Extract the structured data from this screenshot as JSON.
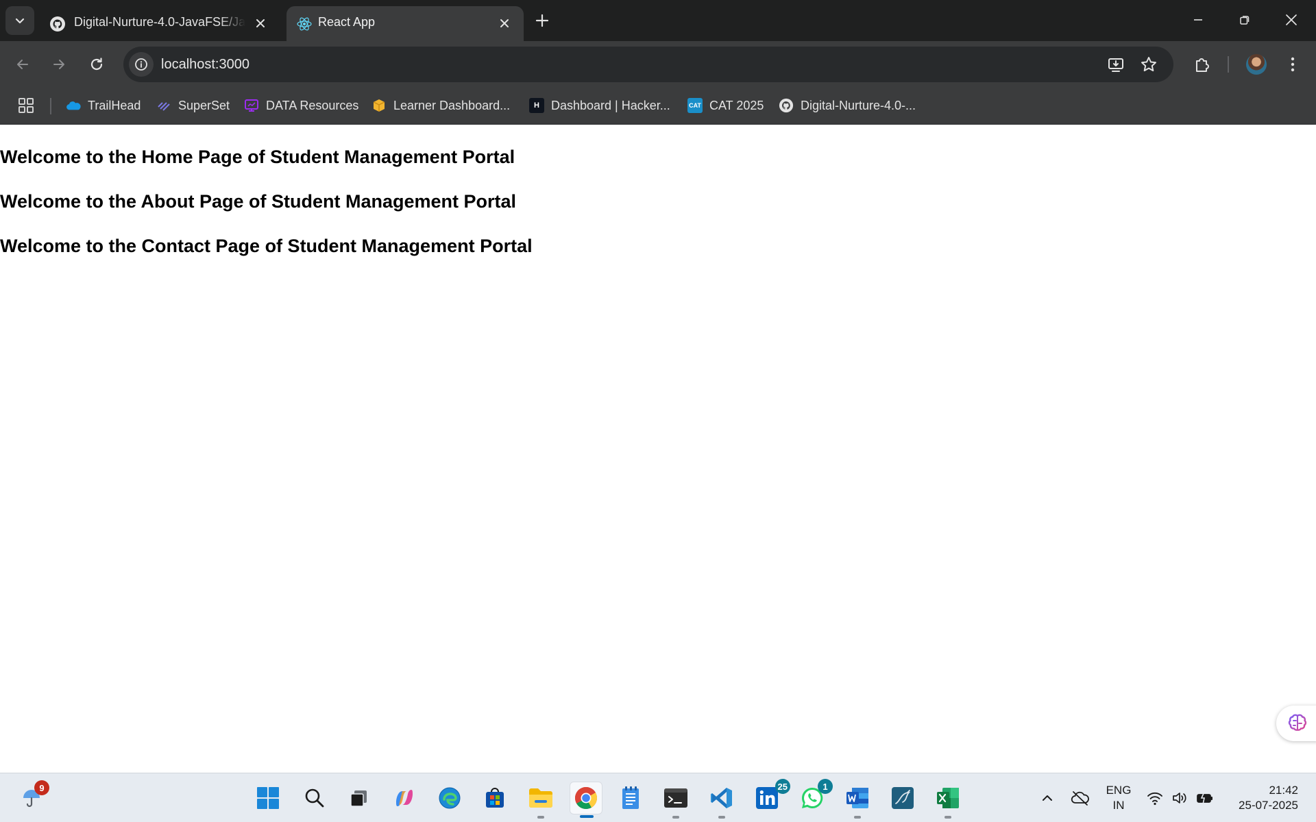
{
  "browser": {
    "tabs": [
      {
        "title": "Digital-Nurture-4.0-JavaFSE/Java",
        "active": false,
        "icon": "github-icon"
      },
      {
        "title": "React App",
        "active": true,
        "icon": "react-icon"
      }
    ],
    "url": "localhost:3000",
    "bookmarks": [
      {
        "label": "TrailHead",
        "icon": "salesforce-cloud-icon"
      },
      {
        "label": "SuperSet",
        "icon": "superset-icon"
      },
      {
        "label": "DATA Resources",
        "icon": "data-resources-icon"
      },
      {
        "label": "Learner Dashboard...",
        "icon": "learner-box-icon"
      },
      {
        "label": "Dashboard | Hacker...",
        "icon": "hackerrank-icon",
        "icon_text": "H"
      },
      {
        "label": "CAT 2025",
        "icon": "cat-icon",
        "icon_text": "CAT"
      },
      {
        "label": "Digital-Nurture-4.0-...",
        "icon": "github-icon"
      }
    ]
  },
  "page": {
    "headings": [
      "Welcome to the Home Page of Student Management Portal",
      "Welcome to the About Page of Student Management Portal",
      "Welcome to the Contact Page of Student Management Portal"
    ]
  },
  "taskbar": {
    "weather_badge": "9",
    "linkedin_badge": "25",
    "whatsapp_badge": "1",
    "language_line1": "ENG",
    "language_line2": "IN",
    "time": "21:42",
    "date": "25-07-2025"
  },
  "colors": {
    "tabbar_bg": "#1f2020",
    "toolbar_bg": "#3b3c3d",
    "omnibox_bg": "#282a2c",
    "taskbar_bg": "#e6ebf1"
  }
}
